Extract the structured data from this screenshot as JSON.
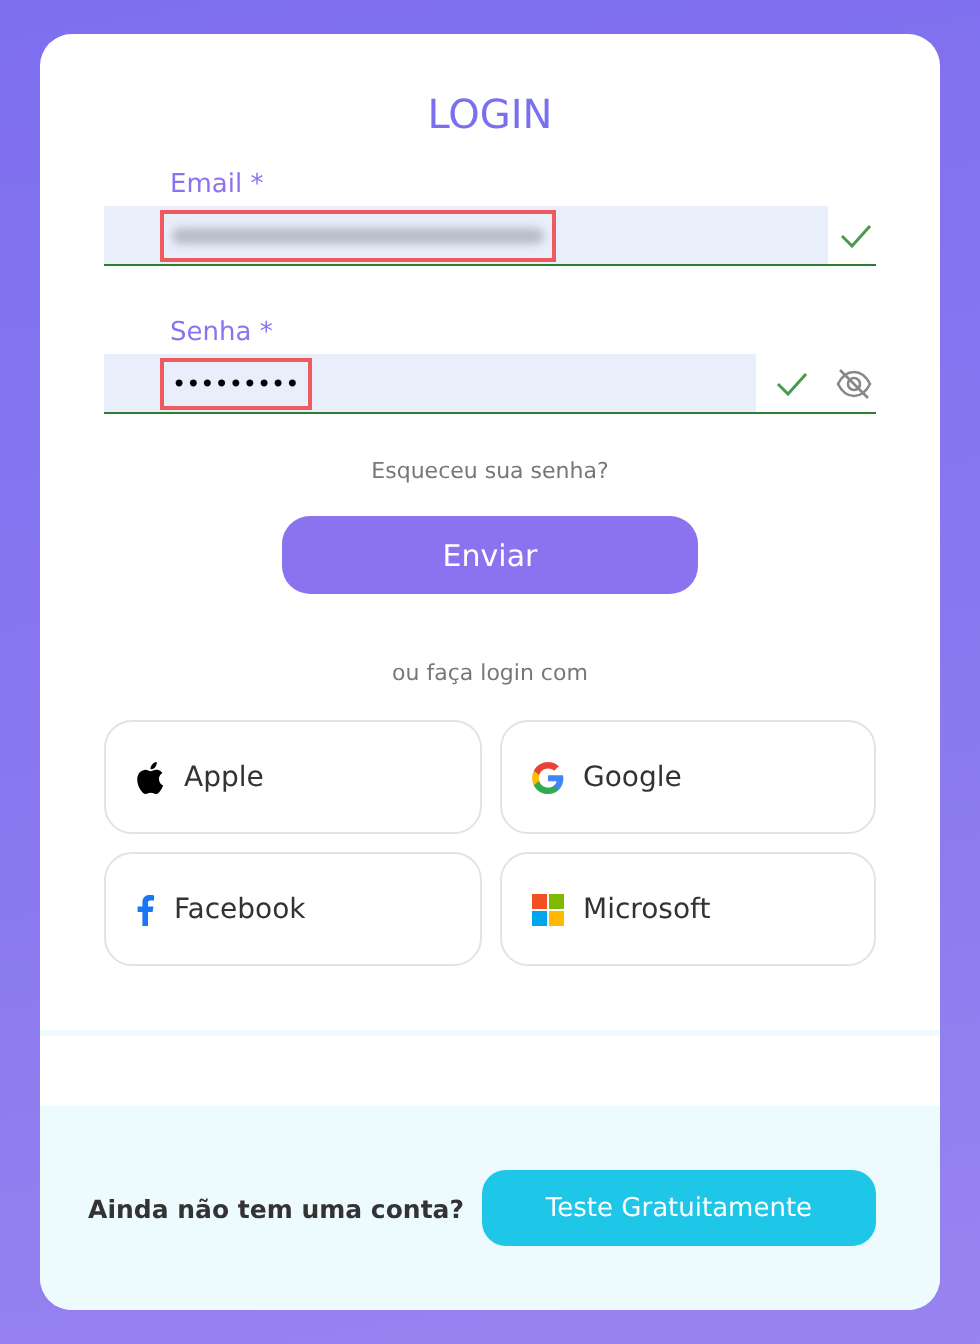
{
  "title": "LOGIN",
  "fields": [
    {
      "kind": "email",
      "label": "Email *",
      "blurred": true,
      "valid": true,
      "highlighted": true
    },
    {
      "kind": "password",
      "label": "Senha *",
      "value": "•••••••••",
      "valid": true,
      "highlighted": true
    }
  ],
  "forgot_link": "Esqueceu sua senha?",
  "submit_button": "Enviar",
  "social_caption": "ou faça login com",
  "social_buttons": [
    {
      "kind": "apple",
      "label": "Apple"
    },
    {
      "kind": "google",
      "label": "Google"
    },
    {
      "kind": "facebook",
      "label": "Facebook"
    },
    {
      "kind": "microsoft",
      "label": "Microsoft"
    }
  ],
  "footer": {
    "text": "Ainda não tem uma conta?",
    "button": "Teste Gratuitamente"
  }
}
